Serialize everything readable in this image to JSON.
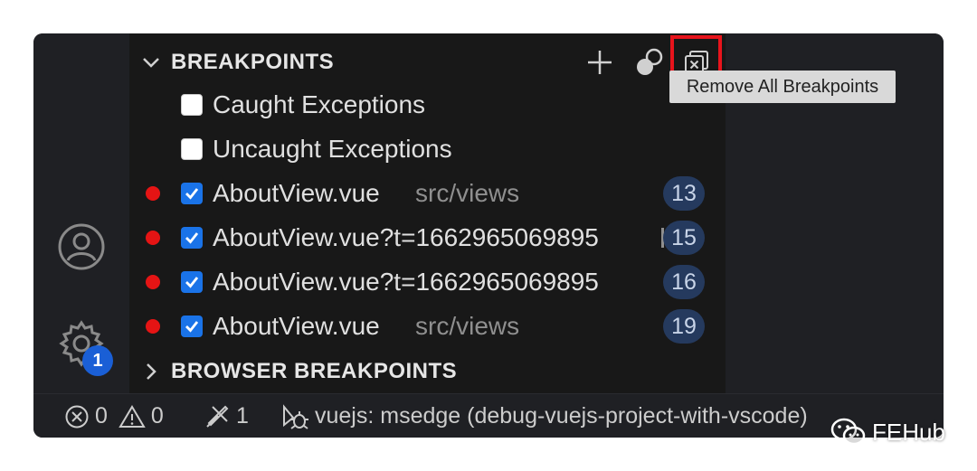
{
  "breakpoints_section": {
    "title": "BREAKPOINTS",
    "options": [
      {
        "label": "Caught Exceptions",
        "checked": false
      },
      {
        "label": "Uncaught Exceptions",
        "checked": false
      }
    ],
    "items": [
      {
        "file": "AboutView.vue",
        "path": "src/views",
        "line": "13",
        "checked": true
      },
      {
        "file": "AboutView.vue?t=1662965069895",
        "path": "",
        "line": "15",
        "checked": true
      },
      {
        "file": "AboutView.vue?t=1662965069895",
        "path": "",
        "line": "16",
        "checked": true
      },
      {
        "file": "AboutView.vue",
        "path": "src/views",
        "line": "19",
        "checked": true
      }
    ]
  },
  "browser_breakpoints_section": {
    "title": "BROWSER BREAKPOINTS"
  },
  "tooltip": {
    "text": "Remove All Breakpoints"
  },
  "activity_bar": {
    "settings_badge": "1"
  },
  "status_bar": {
    "errors": "0",
    "warnings": "0",
    "tools_count": "1",
    "debug_session": "vuejs: msedge (debug-vuejs-project-with-vscode)"
  },
  "watermark": {
    "text": "FEHub"
  },
  "colors": {
    "panel": "#181818",
    "breakpoint_dot": "#e51414",
    "checkbox_checked": "#1a73e8",
    "line_badge": "#253a5e",
    "highlight": "#e8141c"
  }
}
